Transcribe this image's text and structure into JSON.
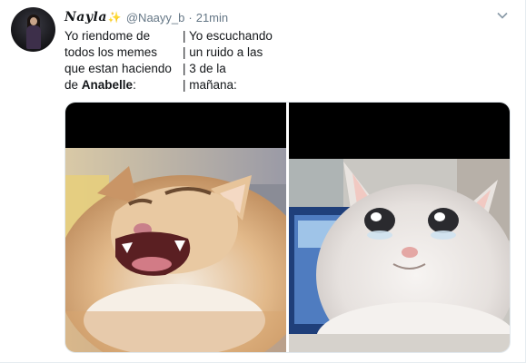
{
  "tweet": {
    "display_name": "Nayla",
    "badge_icon": "sparkle-icon",
    "handle": "@Naayy_b",
    "separator": "·",
    "time": "21min",
    "text_rows": [
      {
        "left": "Yo riendome de",
        "right": "| Yo escuchando"
      },
      {
        "left": "todos los memes",
        "right": "| un ruido a las"
      },
      {
        "left": "que estan haciendo",
        "right": "| 3 de la"
      },
      {
        "left_prefix": "de ",
        "left_bold": "Anabelle",
        "left_suffix": ":",
        "right": "| mañana:"
      }
    ],
    "media": [
      "laughing-cat-photo",
      "crying-cat-photo"
    ]
  },
  "colors": {
    "text": "#14171a",
    "secondary": "#657786",
    "border": "#e6ecf0",
    "sparkle": "#f2b01e"
  }
}
